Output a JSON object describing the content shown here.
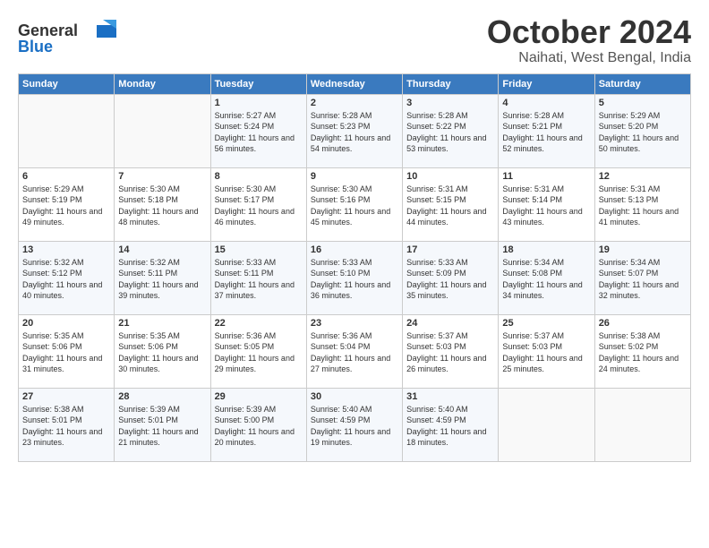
{
  "header": {
    "logo_line1": "General",
    "logo_line2": "Blue",
    "month": "October 2024",
    "location": "Naihati, West Bengal, India"
  },
  "weekdays": [
    "Sunday",
    "Monday",
    "Tuesday",
    "Wednesday",
    "Thursday",
    "Friday",
    "Saturday"
  ],
  "weeks": [
    [
      {
        "day": "",
        "sunrise": "",
        "sunset": "",
        "daylight": ""
      },
      {
        "day": "",
        "sunrise": "",
        "sunset": "",
        "daylight": ""
      },
      {
        "day": "1",
        "sunrise": "Sunrise: 5:27 AM",
        "sunset": "Sunset: 5:24 PM",
        "daylight": "Daylight: 11 hours and 56 minutes."
      },
      {
        "day": "2",
        "sunrise": "Sunrise: 5:28 AM",
        "sunset": "Sunset: 5:23 PM",
        "daylight": "Daylight: 11 hours and 54 minutes."
      },
      {
        "day": "3",
        "sunrise": "Sunrise: 5:28 AM",
        "sunset": "Sunset: 5:22 PM",
        "daylight": "Daylight: 11 hours and 53 minutes."
      },
      {
        "day": "4",
        "sunrise": "Sunrise: 5:28 AM",
        "sunset": "Sunset: 5:21 PM",
        "daylight": "Daylight: 11 hours and 52 minutes."
      },
      {
        "day": "5",
        "sunrise": "Sunrise: 5:29 AM",
        "sunset": "Sunset: 5:20 PM",
        "daylight": "Daylight: 11 hours and 50 minutes."
      }
    ],
    [
      {
        "day": "6",
        "sunrise": "Sunrise: 5:29 AM",
        "sunset": "Sunset: 5:19 PM",
        "daylight": "Daylight: 11 hours and 49 minutes."
      },
      {
        "day": "7",
        "sunrise": "Sunrise: 5:30 AM",
        "sunset": "Sunset: 5:18 PM",
        "daylight": "Daylight: 11 hours and 48 minutes."
      },
      {
        "day": "8",
        "sunrise": "Sunrise: 5:30 AM",
        "sunset": "Sunset: 5:17 PM",
        "daylight": "Daylight: 11 hours and 46 minutes."
      },
      {
        "day": "9",
        "sunrise": "Sunrise: 5:30 AM",
        "sunset": "Sunset: 5:16 PM",
        "daylight": "Daylight: 11 hours and 45 minutes."
      },
      {
        "day": "10",
        "sunrise": "Sunrise: 5:31 AM",
        "sunset": "Sunset: 5:15 PM",
        "daylight": "Daylight: 11 hours and 44 minutes."
      },
      {
        "day": "11",
        "sunrise": "Sunrise: 5:31 AM",
        "sunset": "Sunset: 5:14 PM",
        "daylight": "Daylight: 11 hours and 43 minutes."
      },
      {
        "day": "12",
        "sunrise": "Sunrise: 5:31 AM",
        "sunset": "Sunset: 5:13 PM",
        "daylight": "Daylight: 11 hours and 41 minutes."
      }
    ],
    [
      {
        "day": "13",
        "sunrise": "Sunrise: 5:32 AM",
        "sunset": "Sunset: 5:12 PM",
        "daylight": "Daylight: 11 hours and 40 minutes."
      },
      {
        "day": "14",
        "sunrise": "Sunrise: 5:32 AM",
        "sunset": "Sunset: 5:11 PM",
        "daylight": "Daylight: 11 hours and 39 minutes."
      },
      {
        "day": "15",
        "sunrise": "Sunrise: 5:33 AM",
        "sunset": "Sunset: 5:11 PM",
        "daylight": "Daylight: 11 hours and 37 minutes."
      },
      {
        "day": "16",
        "sunrise": "Sunrise: 5:33 AM",
        "sunset": "Sunset: 5:10 PM",
        "daylight": "Daylight: 11 hours and 36 minutes."
      },
      {
        "day": "17",
        "sunrise": "Sunrise: 5:33 AM",
        "sunset": "Sunset: 5:09 PM",
        "daylight": "Daylight: 11 hours and 35 minutes."
      },
      {
        "day": "18",
        "sunrise": "Sunrise: 5:34 AM",
        "sunset": "Sunset: 5:08 PM",
        "daylight": "Daylight: 11 hours and 34 minutes."
      },
      {
        "day": "19",
        "sunrise": "Sunrise: 5:34 AM",
        "sunset": "Sunset: 5:07 PM",
        "daylight": "Daylight: 11 hours and 32 minutes."
      }
    ],
    [
      {
        "day": "20",
        "sunrise": "Sunrise: 5:35 AM",
        "sunset": "Sunset: 5:06 PM",
        "daylight": "Daylight: 11 hours and 31 minutes."
      },
      {
        "day": "21",
        "sunrise": "Sunrise: 5:35 AM",
        "sunset": "Sunset: 5:06 PM",
        "daylight": "Daylight: 11 hours and 30 minutes."
      },
      {
        "day": "22",
        "sunrise": "Sunrise: 5:36 AM",
        "sunset": "Sunset: 5:05 PM",
        "daylight": "Daylight: 11 hours and 29 minutes."
      },
      {
        "day": "23",
        "sunrise": "Sunrise: 5:36 AM",
        "sunset": "Sunset: 5:04 PM",
        "daylight": "Daylight: 11 hours and 27 minutes."
      },
      {
        "day": "24",
        "sunrise": "Sunrise: 5:37 AM",
        "sunset": "Sunset: 5:03 PM",
        "daylight": "Daylight: 11 hours and 26 minutes."
      },
      {
        "day": "25",
        "sunrise": "Sunrise: 5:37 AM",
        "sunset": "Sunset: 5:03 PM",
        "daylight": "Daylight: 11 hours and 25 minutes."
      },
      {
        "day": "26",
        "sunrise": "Sunrise: 5:38 AM",
        "sunset": "Sunset: 5:02 PM",
        "daylight": "Daylight: 11 hours and 24 minutes."
      }
    ],
    [
      {
        "day": "27",
        "sunrise": "Sunrise: 5:38 AM",
        "sunset": "Sunset: 5:01 PM",
        "daylight": "Daylight: 11 hours and 23 minutes."
      },
      {
        "day": "28",
        "sunrise": "Sunrise: 5:39 AM",
        "sunset": "Sunset: 5:01 PM",
        "daylight": "Daylight: 11 hours and 21 minutes."
      },
      {
        "day": "29",
        "sunrise": "Sunrise: 5:39 AM",
        "sunset": "Sunset: 5:00 PM",
        "daylight": "Daylight: 11 hours and 20 minutes."
      },
      {
        "day": "30",
        "sunrise": "Sunrise: 5:40 AM",
        "sunset": "Sunset: 4:59 PM",
        "daylight": "Daylight: 11 hours and 19 minutes."
      },
      {
        "day": "31",
        "sunrise": "Sunrise: 5:40 AM",
        "sunset": "Sunset: 4:59 PM",
        "daylight": "Daylight: 11 hours and 18 minutes."
      },
      {
        "day": "",
        "sunrise": "",
        "sunset": "",
        "daylight": ""
      },
      {
        "day": "",
        "sunrise": "",
        "sunset": "",
        "daylight": ""
      }
    ]
  ]
}
